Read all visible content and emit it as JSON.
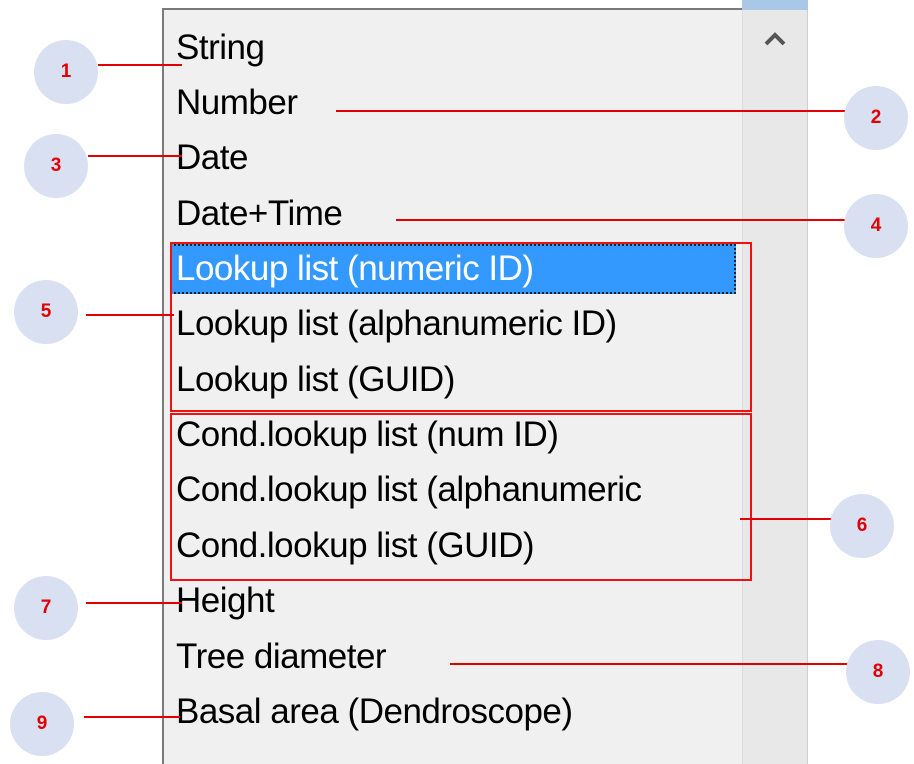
{
  "list": {
    "items": [
      "String",
      "Number",
      "Date",
      "Date+Time",
      "Lookup list (numeric ID)",
      "Lookup list (alphanumeric ID)",
      "Lookup list (GUID)",
      "Cond.lookup list (num ID)",
      "Cond.lookup list (alphanumeric",
      "Cond.lookup list (GUID)",
      "Height",
      "Tree diameter",
      "Basal area (Dendroscope)"
    ],
    "selected_index": 4
  },
  "callouts": [
    "1",
    "2",
    "3",
    "4",
    "5",
    "6",
    "7",
    "8",
    "9"
  ],
  "colors": {
    "selection": "#3399ff",
    "annotation": "#e00000",
    "callout_fill": "#d9e0f2"
  }
}
